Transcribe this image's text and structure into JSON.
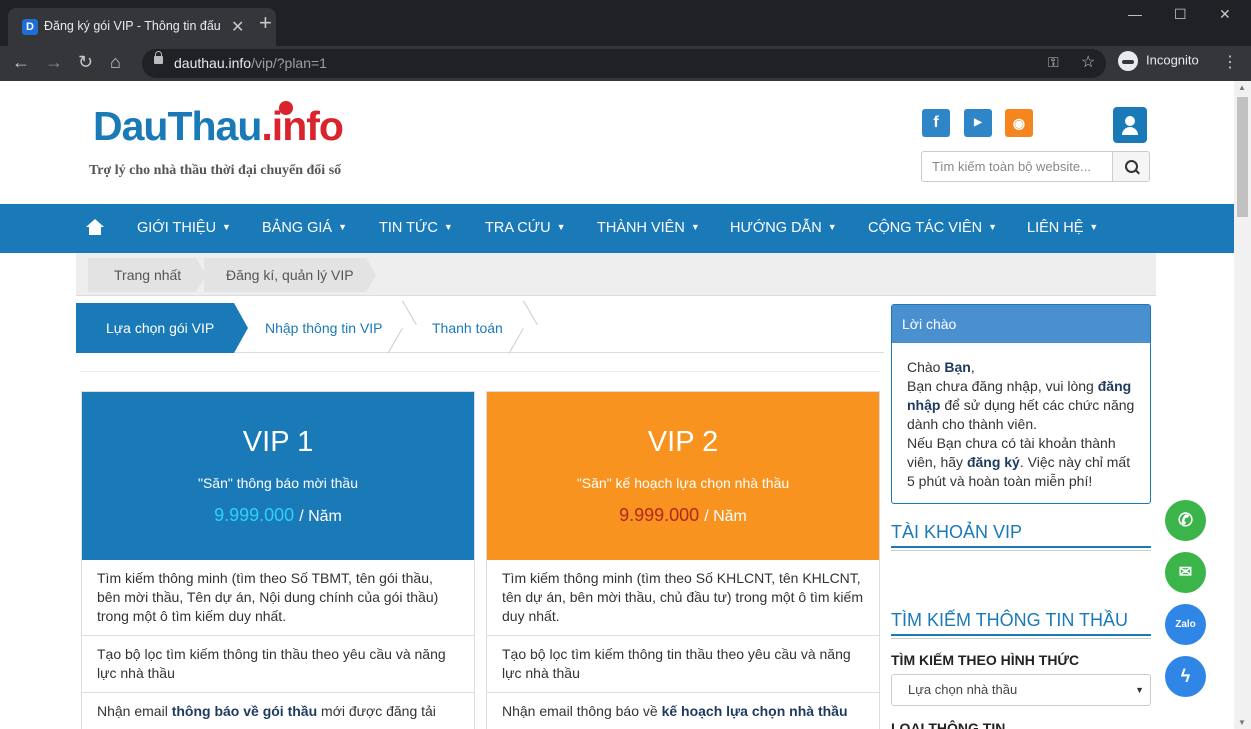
{
  "browser": {
    "tab_title": "Đăng ký gói VIP - Thông tin đấu",
    "favicon_letter": "D",
    "url_host": "dauthau.info",
    "url_path": "/vip/?plan=1",
    "profile_label": "Incognito"
  },
  "header": {
    "logo_part1": "DauThau",
    "logo_part2": ".info",
    "tagline": "Trợ lý cho nhà thầu thời đại chuyển đổi số",
    "search_placeholder": "Tìm kiếm toàn bộ website...",
    "social": [
      "facebook-icon",
      "youtube-icon",
      "rss-icon"
    ]
  },
  "nav": {
    "items": [
      "GIỚI THIỆU",
      "BẢNG GIÁ",
      "TIN TỨC",
      "TRA CỨU",
      "THÀNH VIÊN",
      "HƯỚNG DẪN",
      "CỘNG TÁC VIÊN",
      "LIÊN HỆ"
    ],
    "caret": "▼"
  },
  "breadcrumb": [
    "Trang nhất",
    "Đăng kí, quản lý VIP"
  ],
  "steps": [
    "Lựa chọn gói VIP",
    "Nhập thông tin VIP",
    "Thanh toán"
  ],
  "plans": [
    {
      "name": "VIP 1",
      "subtitle": "\"Săn\" thông báo mời thầu",
      "price": "9.999.000",
      "unit": "/ Năm",
      "color": "#1a7ab8",
      "price_color": "#2fd0f5",
      "features": [
        "Tìm kiếm thông minh (tìm theo Số TBMT, tên gói thầu, bên mời thầu, Tên dự án, Nội dung chính của gói thầu) trong một ô tìm kiếm duy nhất.",
        "Tạo bộ lọc tìm kiếm thông tin thầu theo yêu cầu và năng lực nhà thầu"
      ],
      "feature3_pre": "Nhận email ",
      "feature3_bold": "thông báo về gói thầu",
      "feature3_post": " mới được đăng tải"
    },
    {
      "name": "VIP 2",
      "subtitle": "\"Săn\" kế hoạch lựa chọn nhà thầu",
      "price": "9.999.000",
      "unit": "/ Năm",
      "color": "#f7931e",
      "price_color": "#b5261e",
      "features": [
        "Tìm kiếm thông minh (tìm theo Số KHLCNT, tên KHLCNT, tên dự án, bên mời thầu, chủ đầu tư) trong một ô tìm kiếm duy nhất.",
        "Tạo bộ lọc tìm kiếm thông tin thầu theo yêu cầu và năng lực nhà thầu"
      ],
      "feature3_pre": "Nhận email thông báo về ",
      "feature3_bold": "kế hoạch lựa chọn nhà thầu",
      "feature3_post": ""
    }
  ],
  "sidebar": {
    "greeting_title": "Lời chào",
    "greeting_line1_pre": "Chào ",
    "greeting_line1_bold": "Bạn",
    "greeting_line1_post": ",",
    "greeting_p2_pre": "Bạn chưa đăng nhập, vui lòng ",
    "greeting_p2_bold": "đăng nhập",
    "greeting_p2_post": " để sử dụng hết các chức năng dành cho thành viên.",
    "greeting_p3_pre": "Nếu Bạn chưa có tài khoản thành viên, hãy ",
    "greeting_p3_bold": "đăng ký",
    "greeting_p3_post": ". Việc này chỉ mất 5 phút và hoàn toàn miễn phí!",
    "vip_heading": "TÀI KHOẢN VIP",
    "search_heading": "TÌM KIẾM THÔNG TIN THẦU",
    "search_type_label": "TÌM KIẾM THEO HÌNH THỨC",
    "search_type_value": "Lựa chọn nhà thầu",
    "next_label": "LOẠI THÔNG TIN"
  },
  "floating": [
    "phone-icon",
    "sms-icon",
    "zalo-icon",
    "messenger-icon"
  ],
  "floating_zalo_text": "Zalo"
}
